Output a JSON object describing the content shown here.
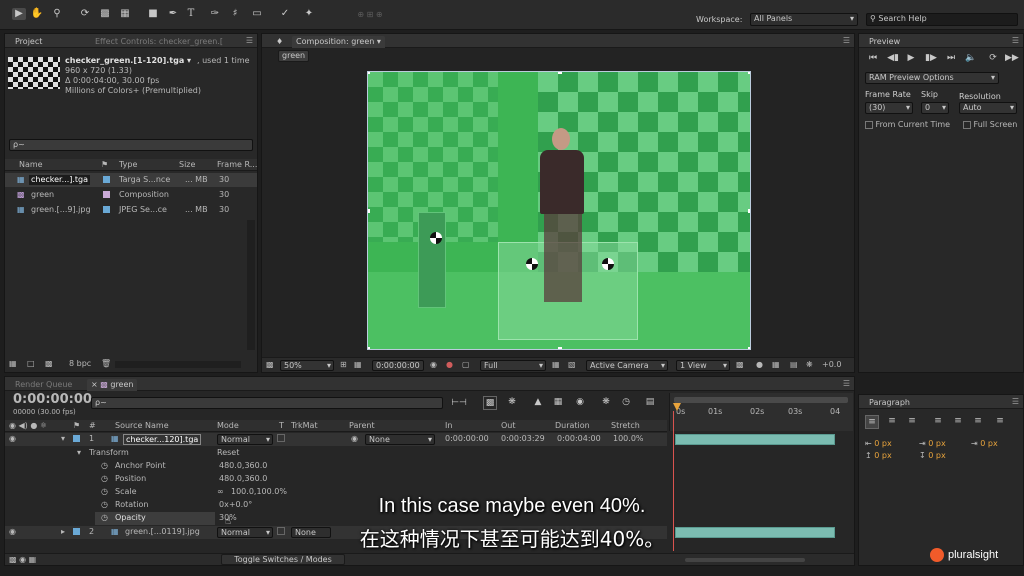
{
  "toolbar": {
    "workspace_label": "Workspace:",
    "workspace_value": "All Panels",
    "search_placeholder": "Search Help"
  },
  "project": {
    "tab_label": "Project",
    "effect_controls_tab": "Effect Controls: checker_green.[",
    "item_name": "checker_green.[1-120].tga",
    "item_used": ", used 1 time",
    "item_size": "960 x 720 (1.33)",
    "item_duration": "Δ 0:00:04:00, 30.00 fps",
    "item_colors": "Millions of Colors+ (Premultiplied)",
    "search_prefix": "ρ~",
    "columns": {
      "name": "Name",
      "type": "Type",
      "size": "Size",
      "frame_rate": "Frame R..."
    },
    "items": [
      {
        "name": "checker...].tga",
        "type": "Targa S...nce",
        "size": "... MB",
        "fps": "30",
        "color": "#6aa9d6"
      },
      {
        "name": "green",
        "type": "Composition",
        "size": "",
        "fps": "30",
        "color": "#c9a9d6"
      },
      {
        "name": "green.[...9].jpg",
        "type": "JPEG Se...ce",
        "size": "... MB",
        "fps": "30",
        "color": "#6aa9d6"
      }
    ],
    "bpc": "8 bpc"
  },
  "composition": {
    "tab_label": "Composition: green",
    "comp_tab": "green",
    "zoom": "50%",
    "timecode": "0:00:00:00",
    "quality": "Full",
    "camera": "Active Camera",
    "view": "1 View",
    "exposure": "+0.0"
  },
  "preview": {
    "tab_label": "Preview",
    "ram_preview": "RAM Preview Options",
    "frame_rate_label": "Frame Rate",
    "skip_label": "Skip",
    "resolution_label": "Resolution",
    "frame_rate_value": "(30)",
    "skip_value": "0",
    "resolution_value": "Auto",
    "from_current_time": "From Current Time",
    "full_screen": "Full Screen"
  },
  "timeline": {
    "render_queue_tab": "Render Queue",
    "green_tab": "green",
    "current_time": "0:00:00:00",
    "frame_info": "00000 (30.00 fps)",
    "search_prefix": "ρ~",
    "columns": {
      "source_name": "Source Name",
      "mode": "Mode",
      "t": "T",
      "trkmat": "TrkMat",
      "parent": "Parent",
      "in": "In",
      "out": "Out",
      "duration": "Duration",
      "stretch": "Stretch"
    },
    "layer1": {
      "number": "1",
      "name": "checker...120].tga",
      "mode": "Normal",
      "parent": "None",
      "in": "0:00:00:00",
      "out": "0:00:03:29",
      "duration": "0:00:04:00",
      "stretch": "100.0%"
    },
    "transform": {
      "label": "Transform",
      "reset": "Reset",
      "anchor_label": "Anchor Point",
      "anchor_value": "480.0,360.0",
      "position_label": "Position",
      "position_value": "480.0,360.0",
      "scale_label": "Scale",
      "scale_value": "100.0,100.0%",
      "rotation_label": "Rotation",
      "rotation_value": "0x+0.0°",
      "opacity_label": "Opacity",
      "opacity_value": "30%"
    },
    "layer2": {
      "number": "2",
      "name": "green.[...0119].jpg",
      "mode": "Normal",
      "trkmat": "None"
    },
    "ruler": [
      "0s",
      "01s",
      "02s",
      "03s",
      "04"
    ],
    "toggle_label": "Toggle Switches / Modes"
  },
  "paragraph": {
    "tab_label": "Paragraph",
    "values": [
      "0 px",
      "0 px",
      "0 px",
      "0 px",
      "0 px"
    ]
  },
  "subtitles": {
    "english": "In this case maybe even 40%.",
    "chinese": "在这种情况下甚至可能达到40%。"
  },
  "brand": {
    "logo_text": "pluralsight"
  }
}
